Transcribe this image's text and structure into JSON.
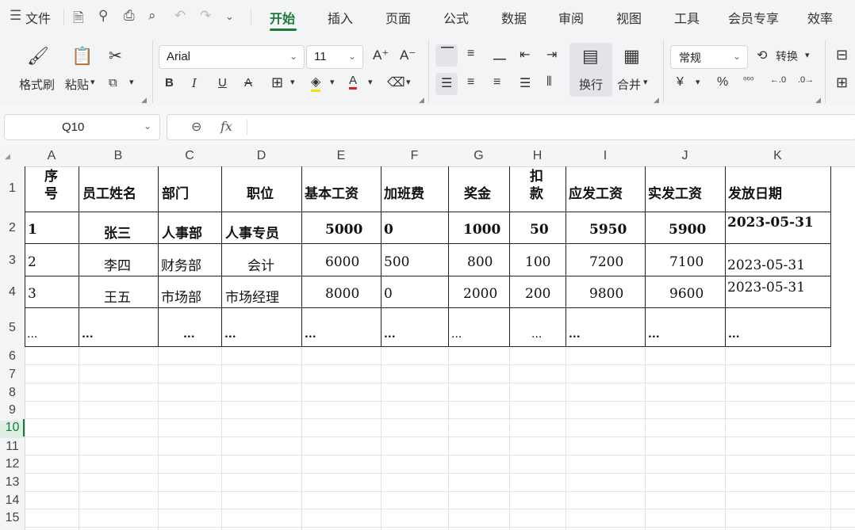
{
  "menubar": {
    "file_label": "文件",
    "tabs": [
      "开始",
      "插入",
      "页面",
      "公式",
      "数据",
      "审阅",
      "视图",
      "工具",
      "会员专享",
      "效率"
    ]
  },
  "ribbon": {
    "format_painter": "格式刷",
    "paste": "粘贴",
    "font_name": "Arial",
    "font_size": "11",
    "wrap_text": "换行",
    "merge": "合并",
    "number_format": "常规",
    "convert": "转换"
  },
  "formula_bar": {
    "name_box": "Q10",
    "fx": "fx",
    "formula": ""
  },
  "sheet": {
    "columns": [
      "A",
      "B",
      "C",
      "D",
      "E",
      "F",
      "G",
      "H",
      "I",
      "J",
      "K"
    ],
    "rows": [
      "1",
      "2",
      "3",
      "4",
      "5",
      "6",
      "7",
      "8",
      "9",
      "10",
      "11",
      "12",
      "13",
      "14",
      "15"
    ],
    "headers": {
      "a1_line1": "序",
      "a1_line2": "号",
      "b1": "员工姓名",
      "c1": "部门",
      "d1": "职位",
      "e1": "基本工资",
      "f1": "加班费",
      "g1": "奖金",
      "h1_line1": "扣",
      "h1_line2": "款",
      "i1": "应发工资",
      "j1": "实发工资",
      "k1": "发放日期"
    },
    "records": [
      {
        "no": "1",
        "name": "张三",
        "dept": "人事部",
        "pos": "人事专员",
        "base": "5000",
        "ot": "0",
        "bonus": "1000",
        "deduct": "50",
        "gross": "5950",
        "net": "5900",
        "date": "2023-05-31"
      },
      {
        "no": "2",
        "name": "李四",
        "dept": "财务部",
        "pos": "会计",
        "base": "6000",
        "ot": "500",
        "bonus": "800",
        "deduct": "100",
        "gross": "7200",
        "net": "7100",
        "date": "2023-05-31"
      },
      {
        "no": "3",
        "name": "王五",
        "dept": "市场部",
        "pos": "市场经理",
        "base": "8000",
        "ot": "0",
        "bonus": "2000",
        "deduct": "200",
        "gross": "9800",
        "net": "9600",
        "date": "2023-05-31"
      }
    ],
    "ellipsis": "..."
  }
}
